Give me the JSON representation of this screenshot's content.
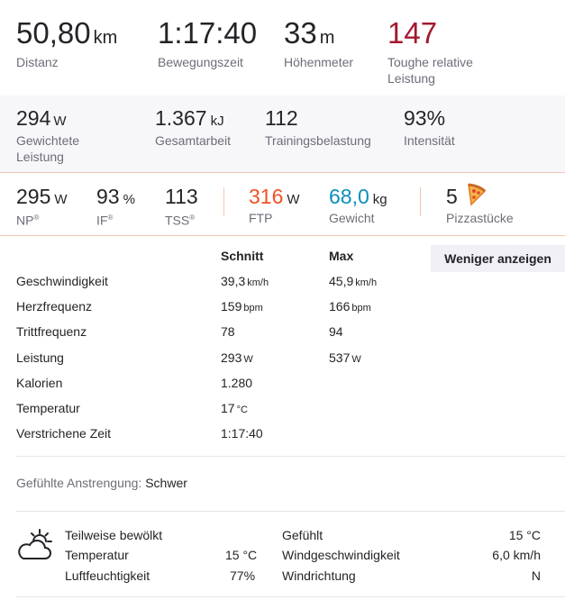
{
  "summary": {
    "distance": {
      "value": "50,80",
      "unit": "km",
      "label": "Distanz"
    },
    "moving_time": {
      "value": "1:17:40",
      "label": "Bewegungszeit"
    },
    "elevation": {
      "value": "33",
      "unit": "m",
      "label": "Höhenmeter"
    },
    "relative_effort": {
      "value": "147",
      "label_line1": "Toughe relative",
      "label_line2": "Leistung",
      "color": "#a3192f"
    }
  },
  "power_summary": {
    "weighted_power": {
      "value": "294",
      "unit": "W",
      "label_line1": "Gewichtete",
      "label_line2": "Leistung"
    },
    "total_work": {
      "value": "1.367",
      "unit": "kJ",
      "label": "Gesamtarbeit"
    },
    "training_load": {
      "value": "112",
      "label": "Trainingsbelastung"
    },
    "intensity": {
      "value": "93%",
      "label": "Intensität"
    }
  },
  "metrics": {
    "np": {
      "value": "295",
      "unit": "W",
      "label": "NP",
      "reg": "®"
    },
    "if": {
      "value": "93",
      "unit": "%",
      "label": "IF",
      "reg": "®"
    },
    "tss": {
      "value": "113",
      "label": "TSS",
      "reg": "®"
    },
    "ftp": {
      "value": "316",
      "unit": "W",
      "label": "FTP",
      "color": "#f05222"
    },
    "weight": {
      "value": "68,0",
      "unit": "kg",
      "label": "Gewicht",
      "color": "#0a8fb8"
    },
    "pizza": {
      "value": "5",
      "label": "Pizzastücke",
      "icon": "pizza-icon"
    }
  },
  "stats_table": {
    "col_avg": "Schnitt",
    "col_max": "Max",
    "toggle_label": "Weniger anzeigen",
    "rows": [
      {
        "label": "Geschwindigkeit",
        "avg": "39,3",
        "avg_unit": "km/h",
        "max": "45,9",
        "max_unit": "km/h"
      },
      {
        "label": "Herzfrequenz",
        "avg": "159",
        "avg_unit": "bpm",
        "max": "166",
        "max_unit": "bpm"
      },
      {
        "label": "Trittfrequenz",
        "avg": "78",
        "avg_unit": "",
        "max": "94",
        "max_unit": ""
      },
      {
        "label": "Leistung",
        "avg": "293",
        "avg_unit": "W",
        "max": "537",
        "max_unit": "W"
      },
      {
        "label": "Kalorien",
        "avg": "1.280",
        "avg_unit": "",
        "max": "",
        "max_unit": ""
      },
      {
        "label": "Temperatur",
        "avg": "17",
        "avg_unit": "°C",
        "max": "",
        "max_unit": ""
      },
      {
        "label": "Verstrichene Zeit",
        "avg": "1:17:40",
        "avg_unit": "",
        "max": "",
        "max_unit": ""
      }
    ]
  },
  "perceived_exertion": {
    "label": "Gefühlte Anstrengung:",
    "value": "Schwer"
  },
  "weather": {
    "icon": "partly-cloudy-icon",
    "condition": "Teilweise bewölkt",
    "temperature_label": "Temperatur",
    "temperature_value": "15 °C",
    "humidity_label": "Luftfeuchtigkeit",
    "humidity_value": "77%",
    "feels_label": "Gefühlt",
    "feels_value": "15 °C",
    "wind_speed_label": "Windgeschwindigkeit",
    "wind_speed_value": "6,0 km/h",
    "wind_dir_label": "Windrichtung",
    "wind_dir_value": "N"
  }
}
